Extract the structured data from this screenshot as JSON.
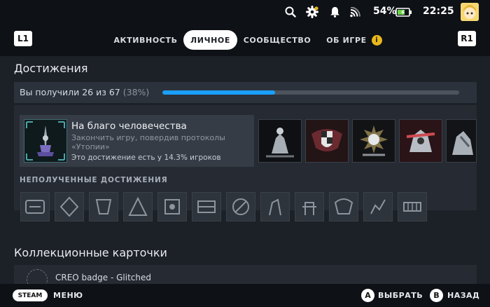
{
  "status": {
    "battery_percent": "54%",
    "time": "22:25",
    "icons": [
      "search-icon",
      "settings-icon",
      "notification-bell-icon",
      "wifi-icon",
      "battery-icon",
      "avatar"
    ]
  },
  "nav": {
    "left_shoulder": "L1",
    "right_shoulder": "R1",
    "tabs": [
      {
        "label": "АКТИВНОСТЬ",
        "active": false
      },
      {
        "label": "ЛИЧНОЕ",
        "active": true
      },
      {
        "label": "СООБЩЕСТВО",
        "active": false
      },
      {
        "label": "ОБ ИГРЕ",
        "active": false
      }
    ],
    "info_badge": "i"
  },
  "achievements": {
    "title": "Достижения",
    "progress_text": "Вы получили 26 из 67",
    "progress_percent_text": "(38%)",
    "progress_fraction": 0.38,
    "featured": {
      "title": "На благо человечества",
      "description": "Закончить игру, повердив протоколы «Утопии»",
      "rarity": "Это достижение есть у 14.3% игроков"
    },
    "unlocked_thumbs": 5,
    "locked_heading": "НЕПОЛУЧЕННЫЕ ДОСТИЖЕНИЯ",
    "locked_thumbs": 12
  },
  "cards": {
    "title": "Коллекционные карточки",
    "item_name": "CREO badge - Glitched"
  },
  "bottom": {
    "steam_label": "STEAM",
    "menu_label": "МЕНЮ",
    "a_button": "A",
    "a_label": "ВЫБРАТЬ",
    "b_button": "B",
    "b_label": "НАЗАД"
  },
  "colors": {
    "accent": "#1a9fff",
    "info": "#e8b81a",
    "battery": "#6bd14a"
  }
}
